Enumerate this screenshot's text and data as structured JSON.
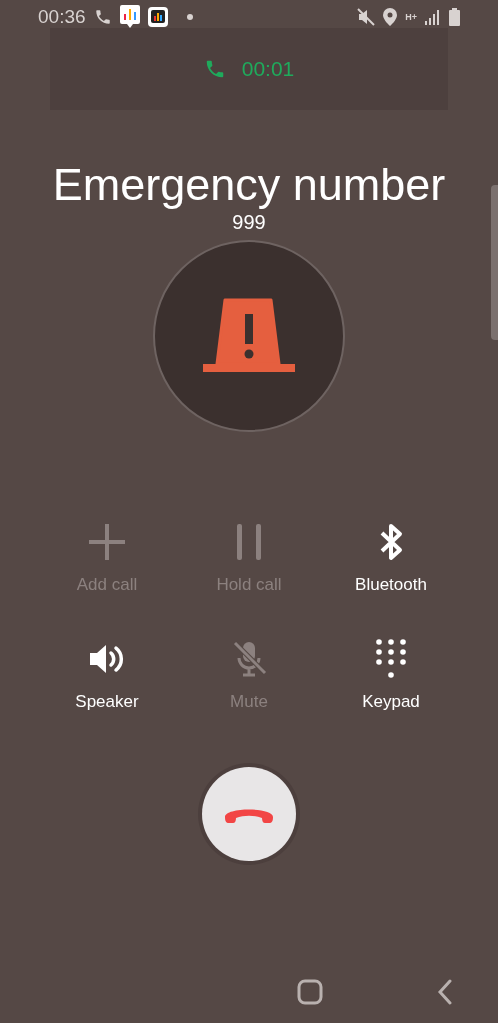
{
  "status_bar": {
    "time": "00:36",
    "network": "H+"
  },
  "call": {
    "duration": "00:01",
    "title": "Emergency number",
    "number": "999"
  },
  "actions": [
    {
      "kind": "add",
      "label": "Add call",
      "disabled": true
    },
    {
      "kind": "hold",
      "label": "Hold call",
      "disabled": true
    },
    {
      "kind": "bluetooth",
      "label": "Bluetooth",
      "disabled": false
    },
    {
      "kind": "speaker",
      "label": "Speaker",
      "disabled": false
    },
    {
      "kind": "mute",
      "label": "Mute",
      "disabled": true
    },
    {
      "kind": "keypad",
      "label": "Keypad",
      "disabled": false
    }
  ]
}
